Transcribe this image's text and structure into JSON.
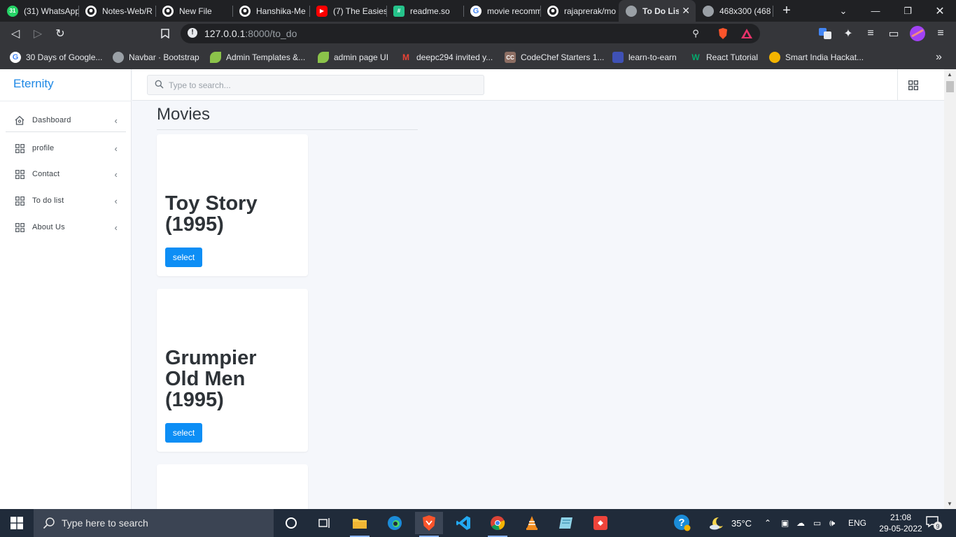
{
  "browser": {
    "tabs": [
      {
        "title": "(31) WhatsApp",
        "favicon": "whatsapp-icon",
        "badge": "31",
        "color": "#25d366"
      },
      {
        "title": "Notes-Web/R",
        "favicon": "github-icon",
        "color": "#ffffff"
      },
      {
        "title": "New File",
        "favicon": "github-icon",
        "color": "#ffffff"
      },
      {
        "title": "Hanshika-Me",
        "favicon": "github-icon",
        "color": "#ffffff"
      },
      {
        "title": "(7) The Easies",
        "favicon": "youtube-icon",
        "color": "#ff0000"
      },
      {
        "title": "readme.so",
        "favicon": "readme-icon",
        "color": "#25c38b"
      },
      {
        "title": "movie recomm",
        "favicon": "google-icon",
        "color": "#ffffff"
      },
      {
        "title": "rajaprerak/mo",
        "favicon": "github-icon",
        "color": "#ffffff"
      },
      {
        "title": "To Do List",
        "favicon": "globe-icon",
        "color": "#9aa0a6",
        "active": true
      },
      {
        "title": "468x300 (468",
        "favicon": "globe-icon",
        "color": "#9aa0a6"
      }
    ],
    "new_tab_label": "+",
    "url_host": "127.0.0.1",
    "url_rest": ":8000/to_do",
    "bookmarks": [
      {
        "label": "30 Days of Google...",
        "icon": "google-icon",
        "color": "#ffffff"
      },
      {
        "label": "Navbar · Bootstrap",
        "icon": "globe-icon",
        "color": "#9aa0a6"
      },
      {
        "label": "Admin Templates &...",
        "icon": "leaf-icon",
        "color": "#8bc34a"
      },
      {
        "label": "admin page UI",
        "icon": "leaf-icon",
        "color": "#8bc34a"
      },
      {
        "label": "deepc294 invited y...",
        "icon": "gmail-icon",
        "color": "#ea4335"
      },
      {
        "label": "CodeChef Starters 1...",
        "icon": "codechef-icon",
        "color": "#8d6e63",
        "text": "CC"
      },
      {
        "label": "learn-to-earn",
        "icon": "learn-icon",
        "color": "#3f51b5"
      },
      {
        "label": "React Tutorial",
        "icon": "w3schools-icon",
        "color": "#04aa6d",
        "text": "W"
      },
      {
        "label": "Smart India Hackat...",
        "icon": "bulb-icon",
        "color": "#f4b400"
      }
    ],
    "bookmarks_overflow": "»"
  },
  "app": {
    "brand": "Eternity",
    "search_placeholder": "Type to search...",
    "nav": [
      {
        "label": "Dashboard",
        "icon": "home-icon"
      },
      {
        "label": "profile",
        "icon": "grid-icon"
      },
      {
        "label": "Contact",
        "icon": "grid-icon"
      },
      {
        "label": "To do list",
        "icon": "grid-icon"
      },
      {
        "label": "About Us",
        "icon": "grid-icon"
      }
    ],
    "chevron": "‹",
    "page_title": "Movies",
    "movies": [
      {
        "title": "Toy Story (1995)",
        "button": "select"
      },
      {
        "title": "Grumpier Old Men (1995)",
        "button": "select"
      },
      {
        "title": "",
        "button": ""
      }
    ]
  },
  "taskbar": {
    "search_text": "Type here to search",
    "weather": "35°C",
    "language": "ENG",
    "time": "21:08",
    "date": "29-05-2022",
    "notification_count": "9"
  }
}
